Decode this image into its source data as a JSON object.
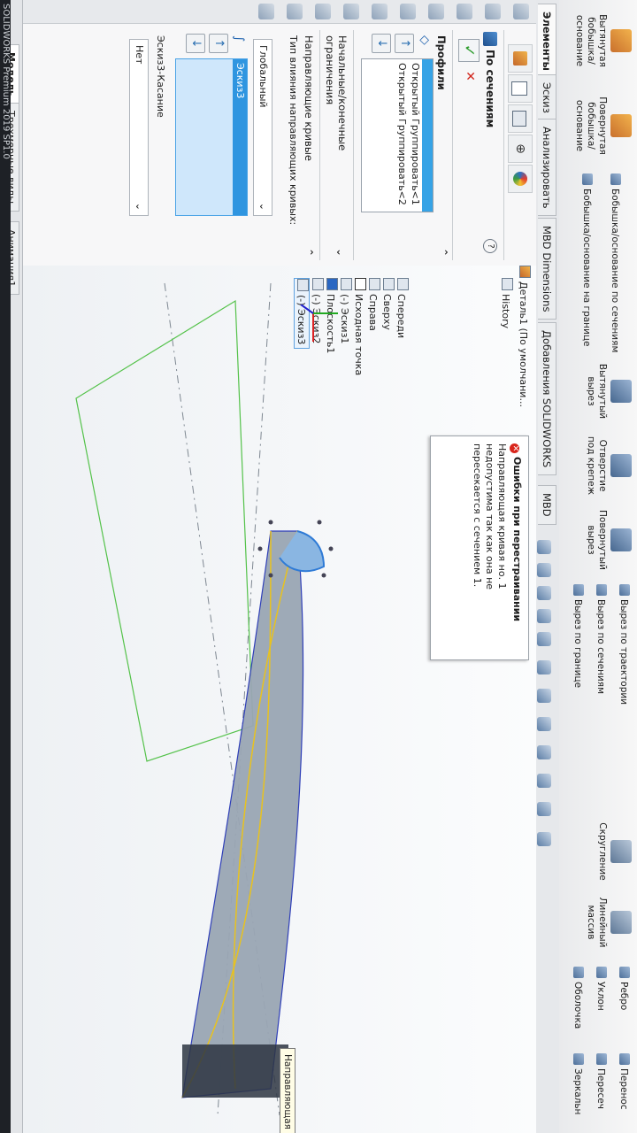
{
  "ribbon": {
    "big_buttons": [
      {
        "label1": "Вытянутая",
        "label2": "бобышка/основание"
      },
      {
        "label1": "Повернутая",
        "label2": "бобышка/основание"
      }
    ],
    "boss_group": [
      "Бобышка/основание по сечениям",
      "Бобышка/основание на границе"
    ],
    "cut_big": [
      {
        "label1": "Вытянутый",
        "label2": "вырез"
      },
      {
        "label1": "Отверстие",
        "label2": "под крепеж"
      },
      {
        "label1": "Повернутый",
        "label2": "вырез"
      }
    ],
    "cut_group": [
      "Вырез по траектории",
      "Вырез по сечениям",
      "Вырез по границе"
    ],
    "fillet_big": [
      {
        "label1": "Скругление",
        "label2": ""
      },
      {
        "label1": "Линейный",
        "label2": "массив"
      }
    ],
    "right_group": [
      "Ребро",
      "Уклон",
      "Оболочка"
    ],
    "far_right": [
      "Перенос",
      "Пересеч",
      "Зеркальн"
    ]
  },
  "tabs": [
    "Элементы",
    "Эскиз",
    "Анализировать",
    "MBD Dimensions",
    "Добавления SOLIDWORKS",
    "MBD"
  ],
  "property_manager": {
    "title": "По сечениям",
    "help": "?",
    "ok_symbol": "✓",
    "cancel_symbol": "✕",
    "profiles_title": "Профили",
    "profiles": [
      "Открытый Группировать<1",
      "Открытый Группировать<2"
    ],
    "constraints_title": "Начальные/конечные ограничения",
    "guides_title": "Направляющие кривые",
    "guide_influence_label": "Тип влияния направляющих кривых:",
    "guide_influence_value": "Глобальный",
    "guides": [
      "Эскиз3"
    ],
    "tangency_label": "Эскиз3-Касание",
    "tangency_value": "Нет"
  },
  "feature_tree": {
    "root": "Деталь1 (По умолчани...",
    "items": [
      "History",
      "Спереди",
      "Сверху",
      "Справа",
      "Исходная точка",
      "(-) Эскиз1",
      "Плоскость1",
      "(-) Эскиз2",
      "(-) Эскиз3"
    ]
  },
  "error_popup": {
    "title": "Ошибки при перестраивании",
    "message": "Направляющая кривая но. 1 недопустима так как она не пересекается с сечением 1."
  },
  "tooltip": "Направляющая крива",
  "bottom_tabs": [
    "Модель",
    "Трехмерные виды",
    "Анимация1"
  ],
  "status_bar": "SOLIDWORKS Premium 2019 SP1.0"
}
